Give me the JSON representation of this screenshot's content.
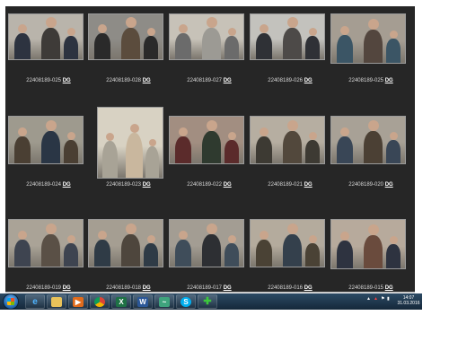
{
  "gallery": {
    "row1_captions": [
      {
        "id": "22408189-025",
        "tag": "DG"
      },
      {
        "id": "22408189-028",
        "tag": "DG"
      },
      {
        "id": "22408189-027",
        "tag": "DG"
      },
      {
        "id": "22408189-026",
        "tag": "DG"
      },
      {
        "id": "22408189-025",
        "tag": "DG"
      }
    ],
    "row2_captions": [
      {
        "id": "22408189-024",
        "tag": "DG"
      },
      {
        "id": "22408189-023",
        "tag": "DG"
      },
      {
        "id": "22408189-022",
        "tag": "DG"
      },
      {
        "id": "22408189-021",
        "tag": "DG"
      },
      {
        "id": "22408189-020",
        "tag": "DG"
      }
    ],
    "row3_captions": [
      {
        "id": "22408189-019",
        "tag": "DG"
      },
      {
        "id": "22408189-018",
        "tag": "DG"
      },
      {
        "id": "22408189-017",
        "tag": "DG"
      },
      {
        "id": "22408189-016",
        "tag": "DG"
      },
      {
        "id": "22408189-015",
        "tag": "DG"
      }
    ]
  },
  "taskbar": {
    "time": "14:07",
    "date": "31.03.2016",
    "apps": [
      "internet-explorer",
      "file-explorer",
      "media-player",
      "chrome",
      "excel",
      "word",
      "sway",
      "skype",
      "plus-app"
    ],
    "word_glyph": "W",
    "skype_glyph": "S"
  },
  "colors": {
    "gallery_bg": "#262626",
    "taskbar": "#1f3a52"
  }
}
